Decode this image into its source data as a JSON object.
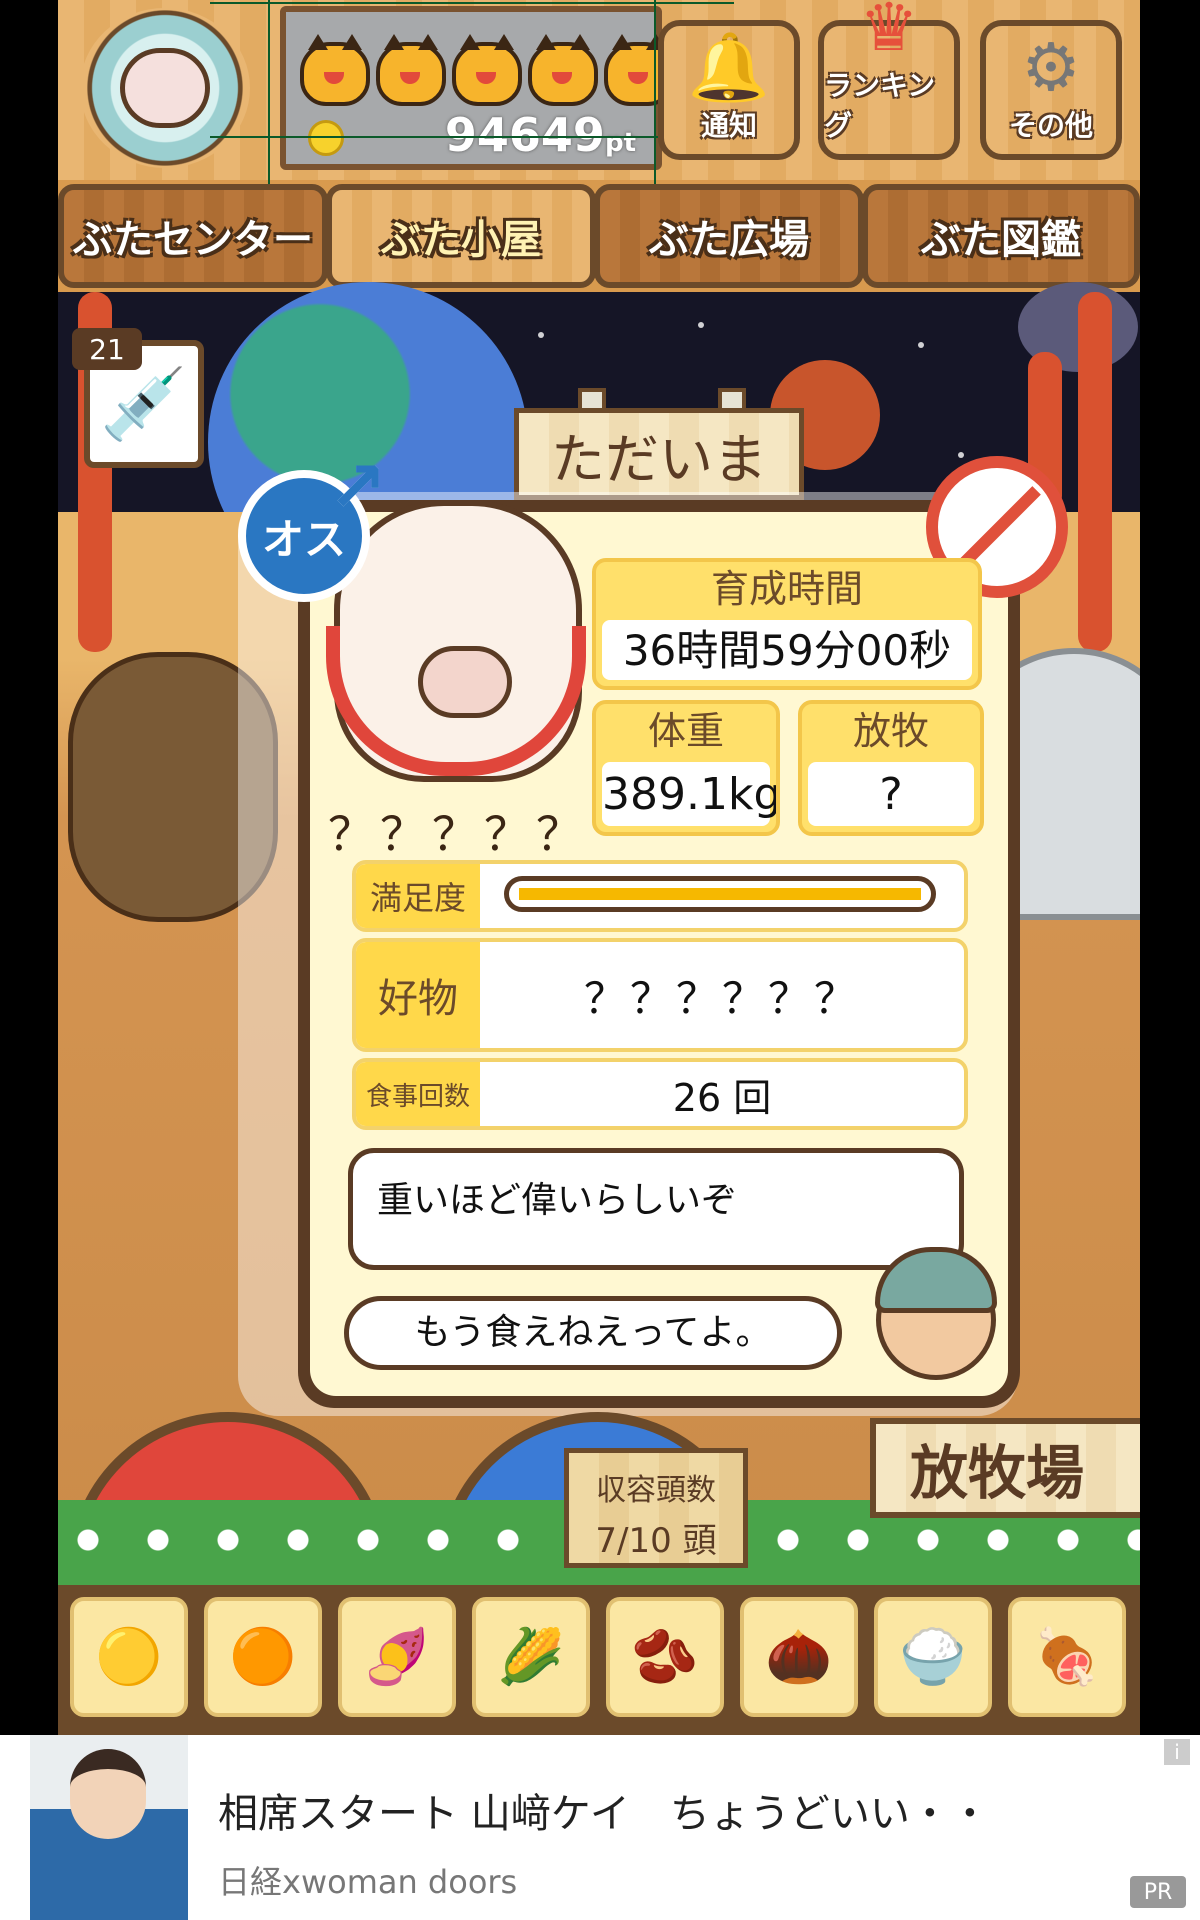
{
  "header": {
    "points_value": "94649",
    "points_unit": "pt",
    "cat_count": 5,
    "buttons": [
      {
        "label": "通知",
        "icon": "bell-icon"
      },
      {
        "label": "ランキング",
        "icon": "crown-icon"
      },
      {
        "label": "その他",
        "icon": "gear-icon"
      }
    ]
  },
  "tabs": [
    "ぶたセンター",
    "ぶた小屋",
    "ぶた広場",
    "ぶた図鑑"
  ],
  "active_tab": "ぶた小屋",
  "syringe": {
    "count": "21"
  },
  "sign": "ただいま",
  "pig": {
    "gender_label": "オス",
    "name": "？？？？？",
    "raise_time_label": "育成時間",
    "raise_time_value": "36時間59分00秒",
    "weight_label": "体重",
    "weight_value": "389.1kg",
    "graze_label": "放牧",
    "graze_value": "?",
    "satisfaction_label": "満足度",
    "satisfaction_level": 1.0,
    "favorite_label": "好物",
    "favorite_value": "？？？？？？",
    "meals_label": "食事回数",
    "meals_value": "26 回",
    "speech_1": "重いほど偉いらしいぞ",
    "speech_2": "もう食えねえってよ。"
  },
  "pen": {
    "capacity_label": "収容頭数",
    "capacity_value": "7/10 頭",
    "pasture_sign": "放牧場"
  },
  "foods": [
    "grain-pile-icon",
    "mixed-feed-icon",
    "sweet-potato-icon",
    "corn-icon",
    "beans-icon",
    "acorn-icon",
    "grain-bowl-icon",
    "meatball-plate-icon"
  ],
  "ad": {
    "title": "相席スタート 山﨑ケイ　ちょうどいい・・",
    "source": "日経xwoman doors",
    "badge": "PR",
    "info": "i"
  },
  "colors": {
    "accent_yellow": "#ffd84a",
    "wood": "#6b4a2a",
    "male_blue": "#2a77c2",
    "warn_red": "#e0503b"
  }
}
